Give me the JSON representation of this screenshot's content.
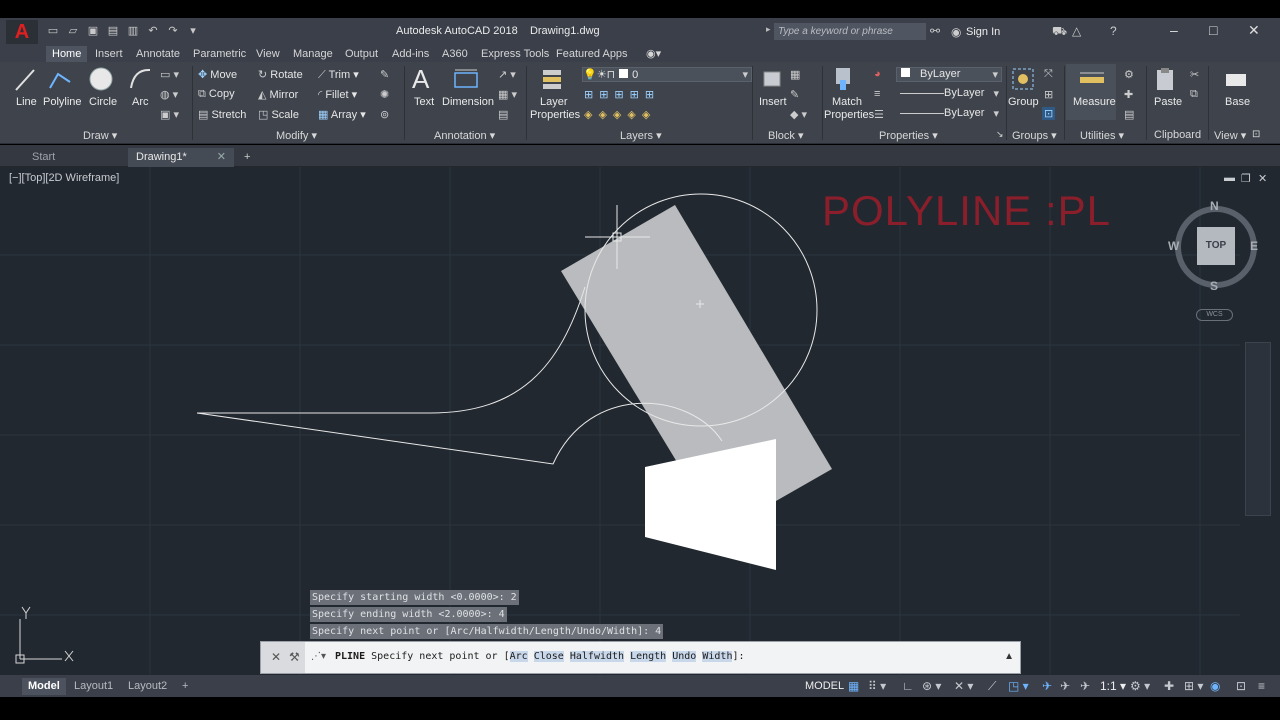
{
  "titlebar": {
    "app_name": "Autodesk AutoCAD 2018",
    "file_name": "Drawing1.dwg",
    "search_placeholder": "Type a keyword or phrase",
    "sign_in": "Sign In"
  },
  "ribbon_tabs": [
    "Home",
    "Insert",
    "Annotate",
    "Parametric",
    "View",
    "Manage",
    "Output",
    "Add-ins",
    "A360",
    "Express Tools",
    "Featured Apps"
  ],
  "ribbon": {
    "draw": {
      "title": "Draw",
      "line": "Line",
      "polyline": "Polyline",
      "circle": "Circle",
      "arc": "Arc"
    },
    "modify": {
      "title": "Modify",
      "move": "Move",
      "rotate": "Rotate",
      "trim": "Trim",
      "copy": "Copy",
      "mirror": "Mirror",
      "fillet": "Fillet",
      "stretch": "Stretch",
      "scale": "Scale",
      "array": "Array"
    },
    "annotation": {
      "title": "Annotation",
      "text": "Text",
      "dimension": "Dimension"
    },
    "layers": {
      "title": "Layers",
      "layer_properties_1": "Layer",
      "layer_properties_2": "Properties",
      "current_layer": "0"
    },
    "block": {
      "title": "Block",
      "insert": "Insert"
    },
    "properties": {
      "title": "Properties",
      "match_1": "Match",
      "match_2": "Properties",
      "color": "ByLayer",
      "linetype": "ByLayer",
      "lineweight": "ByLayer"
    },
    "groups": {
      "title": "Groups",
      "group": "Group"
    },
    "utilities": {
      "title": "Utilities",
      "measure": "Measure"
    },
    "clipboard": {
      "title": "Clipboard",
      "paste": "Paste"
    },
    "view": {
      "title": "View",
      "base": "Base"
    }
  },
  "doc_tabs": {
    "start": "Start",
    "drawing": "Drawing1*"
  },
  "viewport": {
    "label": "[−][Top][2D Wireframe]",
    "watermark": "POLYLINE :PL",
    "viewcube": {
      "n": "N",
      "s": "S",
      "e": "E",
      "w": "W",
      "top": "TOP",
      "wcs": "WCS"
    }
  },
  "command_history": [
    "Specify starting width <0.0000>: 2",
    "Specify ending width <2.0000>: 4",
    "Specify next point or [Arc/Halfwidth/Length/Undo/Width]: 4"
  ],
  "command_line": {
    "command": "PLINE",
    "prompt": "Specify next point or [",
    "options": [
      "Arc",
      "Close",
      "Halfwidth",
      "Length",
      "Undo",
      "Width"
    ],
    "suffix": "]:"
  },
  "layout_tabs": [
    "Model",
    "Layout1",
    "Layout2"
  ],
  "status": {
    "space": "MODEL",
    "scale": "1:1"
  },
  "colors": {
    "viewport_bg": "#212830",
    "watermark": "#8b1e2b",
    "accent": "#1e6bd6",
    "app_red": "#e02020"
  },
  "icons": [
    "app-logo",
    "search-icon",
    "help-icon",
    "cart-icon",
    "crosshair-cursor",
    "ucs-icon",
    "viewcube",
    "gear-icon",
    "plus-icon"
  ]
}
